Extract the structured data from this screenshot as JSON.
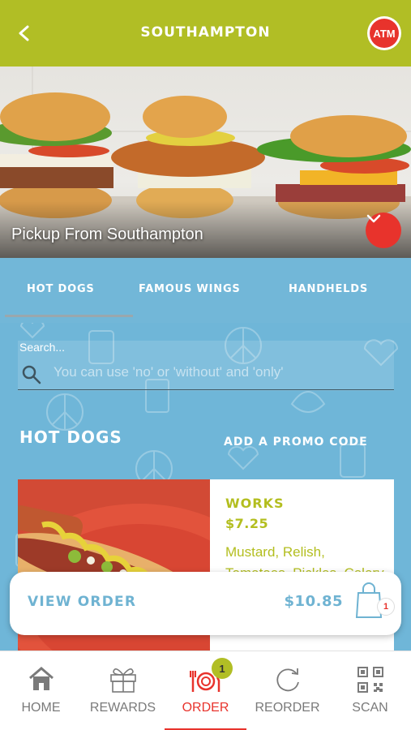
{
  "header": {
    "title": "SOUTHAMPTON",
    "back_icon": "chevron-left-icon",
    "avatar_text": "ATM",
    "colors": {
      "header_bg": "#b1be25",
      "accent_red": "#e8332c"
    }
  },
  "hero": {
    "caption": "Pickup From Southampton",
    "button_icon": "chevron-down-icon"
  },
  "tabs": [
    {
      "label": "HOT DOGS",
      "active": true
    },
    {
      "label": "FAMOUS WINGS",
      "active": false
    },
    {
      "label": "HANDHELDS",
      "active": false
    }
  ],
  "search": {
    "label": "Search...",
    "placeholder": "You can use 'no' or 'without' and 'only'",
    "value": ""
  },
  "section": {
    "title": "HOT DOGS",
    "promo_label": "ADD A PROMO CODE"
  },
  "item": {
    "name": "WORKS",
    "price": "$7.25",
    "description": "Mustard, Relish, Tomatoes, Pickles, Celery Salt"
  },
  "order_bar": {
    "label": "VIEW ORDER",
    "total": "$10.85",
    "bag_count": "1"
  },
  "bottom_nav": [
    {
      "label": "HOME",
      "icon": "home-icon"
    },
    {
      "label": "REWARDS",
      "icon": "gift-icon"
    },
    {
      "label": "ORDER",
      "icon": "plate-utensils-icon",
      "badge": "1",
      "active": true
    },
    {
      "label": "REORDER",
      "icon": "refresh-icon"
    },
    {
      "label": "SCAN",
      "icon": "qr-code-icon"
    }
  ]
}
